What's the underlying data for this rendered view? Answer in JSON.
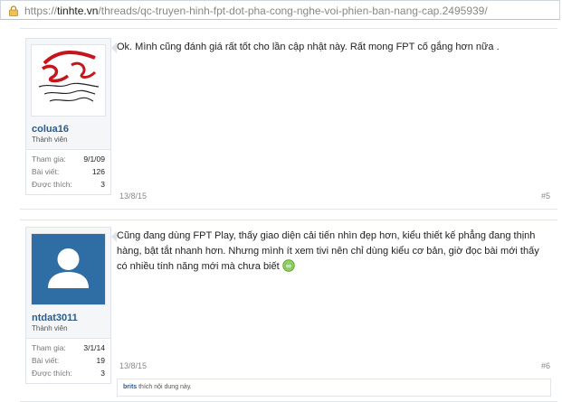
{
  "browser": {
    "url_scheme": "https://",
    "url_host": "tinhte.vn",
    "url_path": "/threads/qc-truyen-hinh-fpt-dot-pha-cong-nghe-voi-phien-ban-nang-cap.2495939/"
  },
  "posts": [
    {
      "username": "colua16",
      "role": "Thành viên",
      "stats": [
        {
          "label": "Tham gia:",
          "value": "9/1/09"
        },
        {
          "label": "Bài viết:",
          "value": "126"
        },
        {
          "label": "Được thích:",
          "value": "3"
        }
      ],
      "message": "Ok. Mình cũng đánh giá rất tốt cho lần cập nhật này. Rất mong FPT cố gắng hơn nữa .",
      "date": "13/8/15",
      "number": "#5",
      "avatar_text": "Sống"
    },
    {
      "username": "ntdat3011",
      "role": "Thành viên",
      "stats": [
        {
          "label": "Tham gia:",
          "value": "3/1/14"
        },
        {
          "label": "Bài viết:",
          "value": "19"
        },
        {
          "label": "Được thích:",
          "value": "3"
        }
      ],
      "message": "Cũng đang dùng FPT Play, thấy giao diện cải tiến nhìn đẹp hơn, kiểu thiết kế phẳng đang thịnh hàng, bật tắt nhanh hơn. Nhưng mình ít xem tivi nên chỉ dùng kiểu cơ bản, giờ đọc bài mới thấy có nhiều tính năng mới mà chưa biết",
      "date": "13/8/15",
      "number": "#6",
      "likes_user": "brits",
      "likes_text": " thích nội dung này."
    }
  ],
  "colors": {
    "username": "#2a5b8c",
    "avatar_blue": "#2f6ea5",
    "border": "#e1e5ea"
  }
}
